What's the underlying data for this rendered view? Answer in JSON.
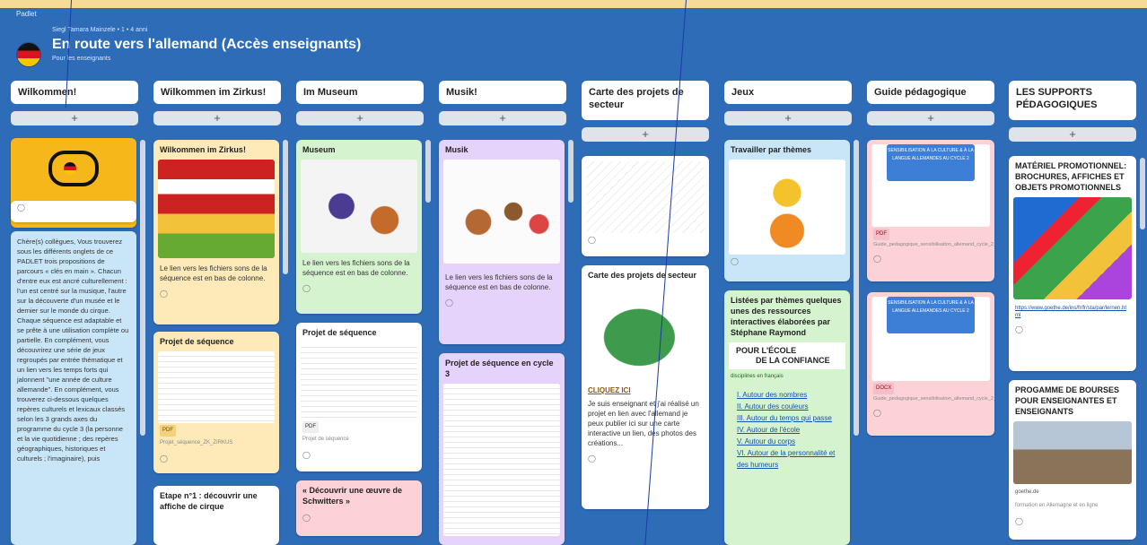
{
  "header": {
    "brand": "Padlet",
    "meta": "Siegl Tamara Mainzele • 1 • 4 anni",
    "title": "En route vers l'allemand (Accès enseignants)",
    "subtitle": "Pour les enseignants"
  },
  "add_symbol": "+",
  "columns": [
    {
      "title": "Wilkommen!"
    },
    {
      "title": "Wilkommen im Zirkus!"
    },
    {
      "title": "Im Museum"
    },
    {
      "title": "Musik!"
    },
    {
      "title": "Carte des projets de secteur"
    },
    {
      "title": "Jeux"
    },
    {
      "title": "Guide pédagogique"
    },
    {
      "title": "LES SUPPORTS PÉDAGOGIQUES"
    }
  ],
  "cards": {
    "welcome_text": {
      "body": "Chère(s) collègues, Vous trouverez sous les différents onglets de ce PADLET trois propositions de parcours « clés en main ». Chacun d'entre eux est ancré culturellement : l'un est centré sur la musique, l'autre sur la découverte d'un musée et le dernier sur le monde du cirque. Chaque séquence est adaptable et se prête à une utilisation complète ou partielle. En complément, vous découvrirez une série de jeux regroupés par entrée thématique et un lien vers les temps forts qui jalonnent \"une année de culture allemande\". En complément, vous trouverez ci-dessous quelques repères culturels et lexicaux classés selon les 3 grands axes du programme du cycle 3 (la personne et la vie quotidienne ; des repères géographiques, historiques et culturels ; l'imaginaire), puis"
    },
    "zirkus": {
      "title": "Wilkommen im Zirkus!",
      "body": "Le lien vers les fichiers sons de la séquence est en bas de colonne."
    },
    "zirkus_projet": {
      "title": "Projet de séquence",
      "file": "Projet_séquence_ZK_ZIRKUS",
      "tag": "PDF"
    },
    "zirkus_etape": {
      "title": "Etape n°1 : découvrir une affiche de cirque"
    },
    "museum": {
      "title": "Museum",
      "body": "Le lien vers les fichiers sons de la séquence est en bas de colonne."
    },
    "museum_projet": {
      "title": "Projet de séquence",
      "file": "Projet de séquence",
      "tag": "PDF"
    },
    "museum_schwitters": {
      "title": "« Découvrir une œuvre de Schwitters »"
    },
    "musik": {
      "title": "Musik",
      "body": "Le lien vers les fichiers sons de la séquence est en bas de colonne."
    },
    "musik_projet": {
      "title": "Projet de séquence en cycle 3"
    },
    "carte": {
      "title": "Carte des projets de secteur",
      "link": "CLIQUEZ ICI",
      "body": "Je suis enseignant et j'ai réalisé un projet en lien avec l'allemand je peux publier ici sur une carte interactive un lien, des photos des créations..."
    },
    "jeux_themes": {
      "title": "Travailler par thèmes"
    },
    "jeux_liste": {
      "title": "Listées par thèmes quelques unes des ressources interactives élaborées par Stéphane Raymond",
      "banner_1": "POUR L'ÉCOLE",
      "banner_2": "DE LA CONFIANCE",
      "banner_sub": "disciplines en français",
      "links": [
        "I. Autour des nombres",
        "II. Autour des couleurs",
        "III. Autour du temps qui passe",
        "IV. Autour de l'école",
        "V. Autour du corps",
        "VI. Autour de la personnalité et des humeurs"
      ]
    },
    "guide_1": {
      "tag": "PDF",
      "file": "Guide_pedagogique_sensibilisation_allemand_cycle_2_version_1.21_2016",
      "box": "SENSIBILISATION À LA CULTURE & À LA LANGUE ALLEMANDES AU CYCLE 2"
    },
    "guide_2": {
      "tag": "DOCX",
      "file": "Guide_pedagogique_sensibilisation_allemand_cycle_2_version_1.21_2016",
      "box": "SENSIBILISATION À LA CULTURE & À LA LANGUE ALLEMANDES AU CYCLE 2"
    },
    "supports_1": {
      "title": "MATÉRIEL PROMOTIONNEL: BROCHURES, AFFICHES ET OBJETS PROMOTIONNELS",
      "link": "https://www.goethe.de/ins/fr/fr/sta/par/lernen.html"
    },
    "supports_2": {
      "title": "PROGAMME DE BOURSES POUR ENSEIGNANTES ET ENSEIGNANTS",
      "source": "goethe.de",
      "body": "formation en Allemagne et en ligne"
    }
  },
  "reaction_icon": "comment-icon"
}
